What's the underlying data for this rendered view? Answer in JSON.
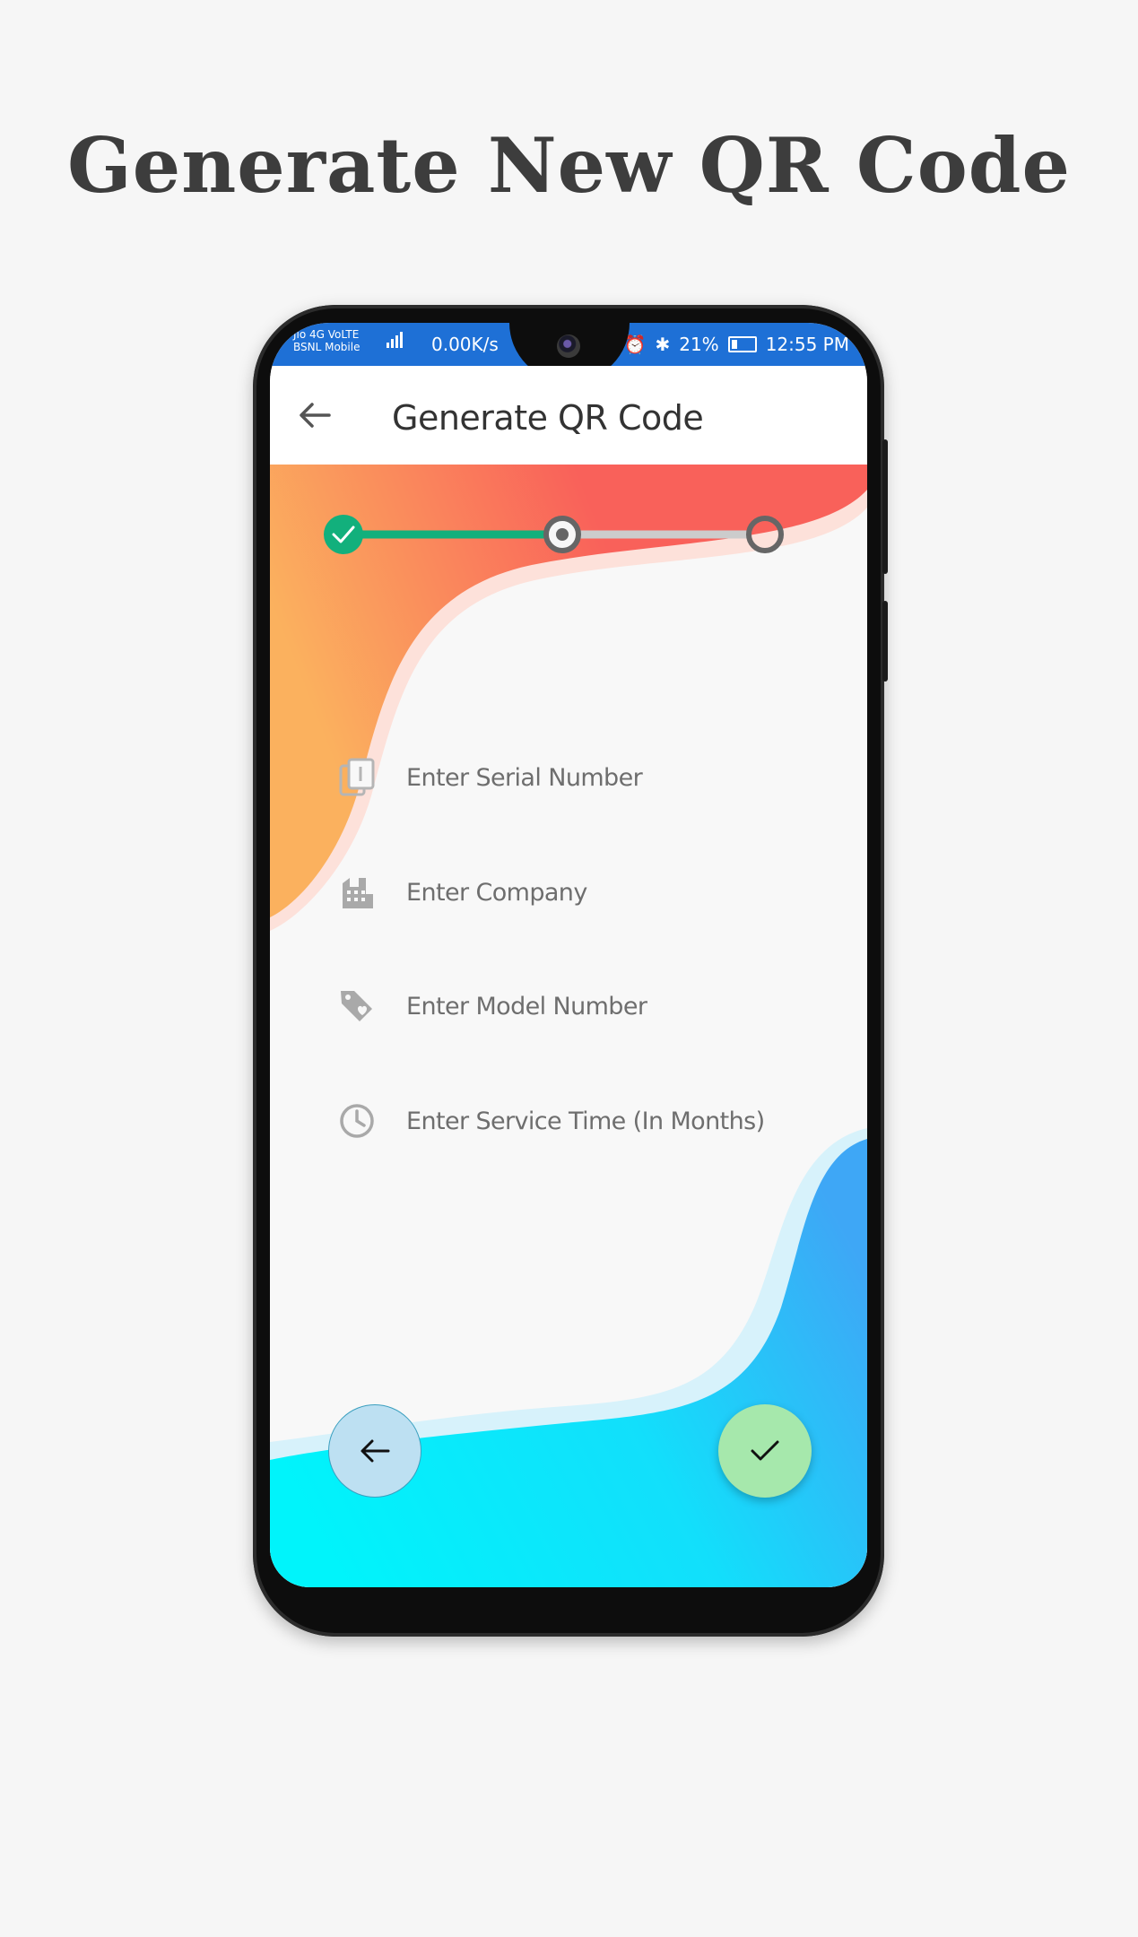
{
  "headline": "Generate New QR Code",
  "status_bar": {
    "carrier_line1": "Jio 4G VoLTE",
    "carrier_line2": "BSNL Mobile",
    "network_speed": "0.00K/s",
    "battery": "21%",
    "time": "12:55 PM"
  },
  "app_bar": {
    "title": "Generate QR Code",
    "back_icon": "arrow-left-icon"
  },
  "stepper": {
    "steps": [
      "completed",
      "current",
      "pending"
    ],
    "colors": {
      "completed": "#12b07c",
      "current": "#666666",
      "pending": "#666666",
      "track_done": "#12b07c",
      "track_todo": "#cccccc"
    }
  },
  "form": {
    "fields": [
      {
        "placeholder": "Enter Serial Number",
        "icon": "serial-number-icon"
      },
      {
        "placeholder": "Enter Company",
        "icon": "building-icon"
      },
      {
        "placeholder": "Enter Model Number",
        "icon": "tag-heart-icon"
      },
      {
        "placeholder": "Enter Service Time (In Months)",
        "icon": "clock-icon"
      }
    ]
  },
  "fabs": {
    "back_icon": "arrow-left-icon",
    "done_icon": "checkmark-icon"
  },
  "colors": {
    "status_bar": "#1e70d6",
    "wave_top_start": "#fbb15e",
    "wave_top_end": "#f9615a",
    "wave_bottom_start": "#00f4fb",
    "wave_bottom_end": "#3ea7f6",
    "fab_back": "#bde0f2",
    "fab_done": "#a6e8ac"
  }
}
